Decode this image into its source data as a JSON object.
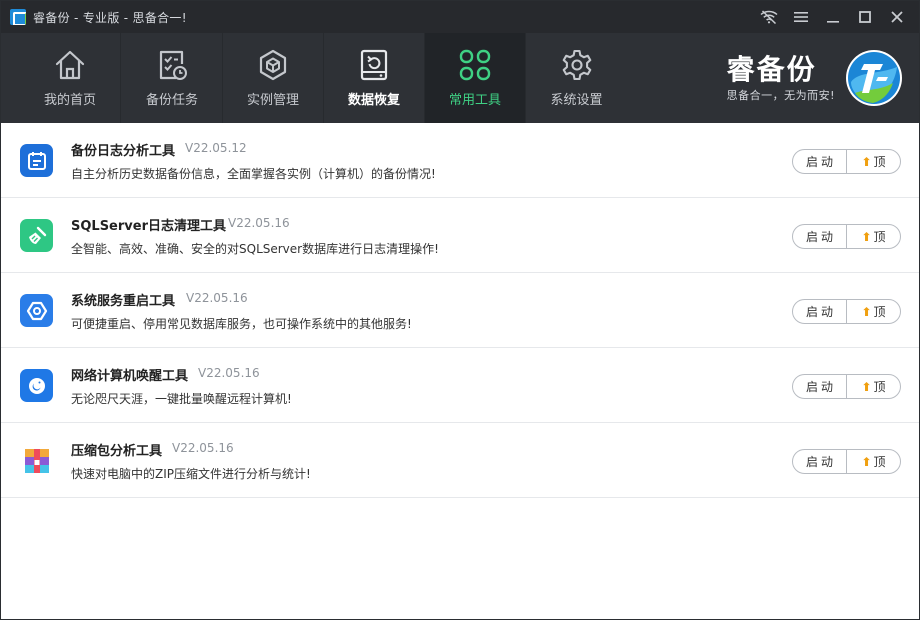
{
  "window": {
    "title": "睿备份 - 专业版 - 思备合一!"
  },
  "nav": {
    "items": [
      {
        "label": "我的首页",
        "icon": "home-icon"
      },
      {
        "label": "备份任务",
        "icon": "task-list-icon"
      },
      {
        "label": "实例管理",
        "icon": "cube-icon"
      },
      {
        "label": "数据恢复",
        "icon": "restore-icon"
      },
      {
        "label": "常用工具",
        "icon": "grid-tools-icon"
      },
      {
        "label": "系统设置",
        "icon": "gear-icon"
      }
    ],
    "active_index": 4
  },
  "brand": {
    "name": "睿备份",
    "slogan": "思备合一，无为而安!"
  },
  "tools": [
    {
      "name": "备份日志分析工具",
      "version": "V22.05.12",
      "desc": "自主分析历史数据备份信息，全面掌握各实例（计算机）的备份情况!",
      "icon": "calendar-icon",
      "color": "#1e6fd9"
    },
    {
      "name": "SQLServer日志清理工具",
      "version": "V22.05.16",
      "desc": "全智能、高效、准确、安全的对SQLServer数据库进行日志清理操作!",
      "icon": "broom-icon",
      "color": "#2ec784"
    },
    {
      "name": "系统服务重启工具",
      "version": "V22.05.16",
      "desc": "可便捷重启、停用常见数据库服务，也可操作系统中的其他服务!",
      "icon": "hexagon-icon",
      "color": "#2a7de8"
    },
    {
      "name": "网络计算机唤醒工具",
      "version": "V22.05.16",
      "desc": "无论咫尺天涯，一键批量唤醒远程计算机!",
      "icon": "wake-icon",
      "color": "#1f78e6"
    },
    {
      "name": "压缩包分析工具",
      "version": "V22.05.16",
      "desc": "快速对电脑中的ZIP压缩文件进行分析与统计!",
      "icon": "archive-icon",
      "color": "#ffffff"
    }
  ],
  "buttons": {
    "start": "启动",
    "top": "顶",
    "top_arrow": "⬆"
  }
}
